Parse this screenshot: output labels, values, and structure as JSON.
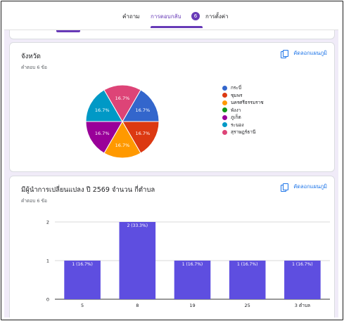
{
  "header": {
    "tabs": [
      {
        "label": "คำถาม",
        "active": false
      },
      {
        "label": "การตอบกลับ",
        "active": true,
        "badge": "6"
      },
      {
        "label": "การตั้งค่า",
        "active": false
      }
    ],
    "accent_color": "#673ab7"
  },
  "card_pie": {
    "title": "จังหวัด",
    "subtitle": "คำตอบ 6 ข้อ",
    "copy_label": "คัดลอกแผนภูมิ"
  },
  "card_bar": {
    "title": "มีผู้นำการเปลี่ยนแปลง ปี 2569 จำนวน กี่ตำบล",
    "subtitle": "คำตอบ 6 ข้อ",
    "copy_label": "คัดลอกแผนภูมิ"
  },
  "chart_data": [
    {
      "type": "pie",
      "title": "จังหวัด",
      "categories": [
        "กระบี่",
        "ชุมพร",
        "นครศรีธรรมราช",
        "พังงา",
        "ภูเก็ต",
        "ระนอง",
        "สุราษฎร์ธานี"
      ],
      "values": [
        1,
        1,
        1,
        0,
        1,
        1,
        1
      ],
      "data_labels": [
        "16.7%",
        "16.7%",
        "16.7%",
        "",
        "16.7%",
        "16.7%",
        "16.7%"
      ],
      "colors": [
        "#3366cc",
        "#dc3912",
        "#ff9900",
        "#109618",
        "#990099",
        "#0099c6",
        "#dd4477"
      ],
      "legend": "right"
    },
    {
      "type": "bar",
      "title": "มีผู้นำการเปลี่ยนแปลง ปี 2569 จำนวน กี่ตำบล",
      "categories": [
        "5",
        "8",
        "19",
        "25",
        "3 ตำบล"
      ],
      "values": [
        1,
        2,
        1,
        1,
        1
      ],
      "data_labels": [
        "1 (16.7%)",
        "2 (33.3%)",
        "1 (16.7%)",
        "1 (16.7%)",
        "1 (16.7%)"
      ],
      "y_ticks": [
        "0",
        "1",
        "2"
      ],
      "ylim": [
        0,
        2
      ],
      "grid": true,
      "color": "#5e4ee0"
    }
  ]
}
